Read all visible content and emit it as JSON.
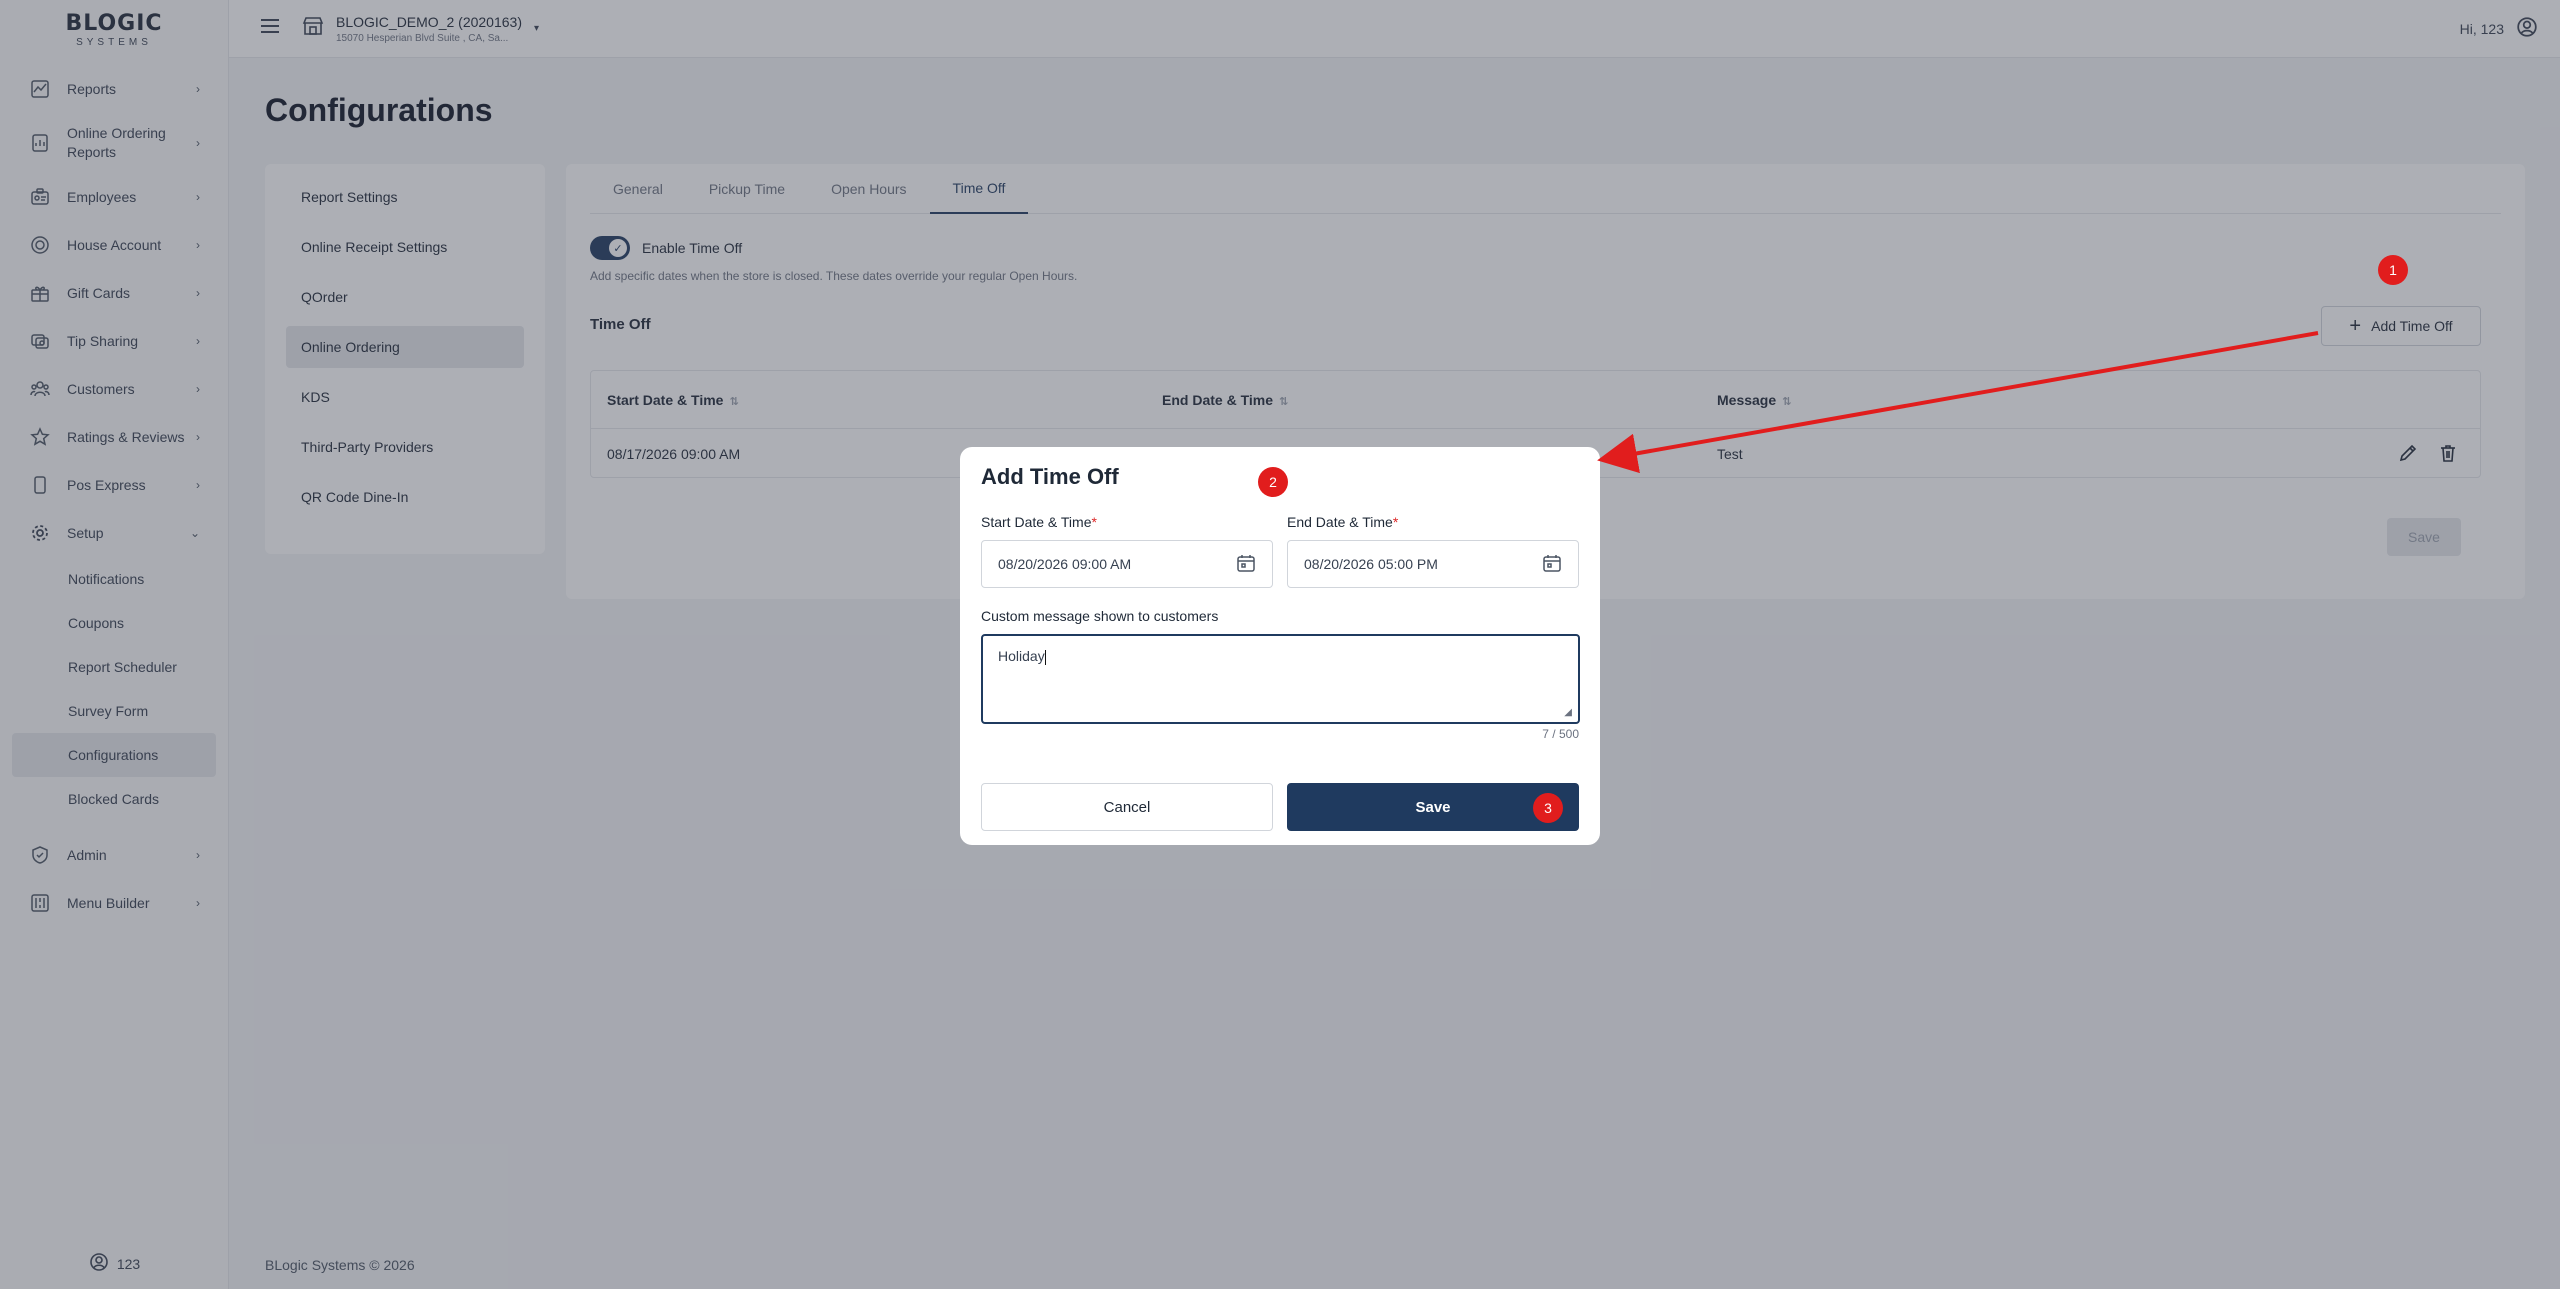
{
  "logo": {
    "line1": "BLOGIC",
    "line2": "SYSTEMS"
  },
  "sidebar": {
    "items": [
      {
        "label": "Reports",
        "icon": "chart-icon"
      },
      {
        "label": "Online Ordering Reports",
        "icon": "report-icon"
      },
      {
        "label": "Employees",
        "icon": "id-card-icon"
      },
      {
        "label": "House Account",
        "icon": "coin-icon"
      },
      {
        "label": "Gift Cards",
        "icon": "gift-icon"
      },
      {
        "label": "Tip Sharing",
        "icon": "tip-icon"
      },
      {
        "label": "Customers",
        "icon": "users-icon"
      },
      {
        "label": "Ratings & Reviews",
        "icon": "star-icon"
      },
      {
        "label": "Pos Express",
        "icon": "device-icon"
      },
      {
        "label": "Setup",
        "icon": "gear-icon"
      }
    ],
    "setup_sub": [
      "Notifications",
      "Coupons",
      "Report Scheduler",
      "Survey Form",
      "Configurations",
      "Blocked Cards"
    ],
    "bottom_items": [
      {
        "label": "Admin",
        "icon": "shield-icon"
      },
      {
        "label": "Menu Builder",
        "icon": "menu-icon"
      }
    ],
    "user": "123"
  },
  "topbar": {
    "store_name": "BLOGIC_DEMO_2 (2020163)",
    "store_address": "15070 Hesperian Blvd Suite , CA, Sa...",
    "greeting": "Hi, 123"
  },
  "page": {
    "title": "Configurations",
    "footer": "BLogic Systems © 2026"
  },
  "settings_nav": [
    "Report Settings",
    "Online Receipt Settings",
    "QOrder",
    "Online Ordering",
    "KDS",
    "Third-Party Providers",
    "QR Code Dine-In"
  ],
  "tabs": [
    "General",
    "Pickup Time",
    "Open Hours",
    "Time Off"
  ],
  "time_off": {
    "toggle_label": "Enable Time Off",
    "toggle_on": true,
    "helper": "Add specific dates when the store is closed. These dates override your regular Open Hours.",
    "section_title": "Time Off",
    "add_button": "Add Time Off",
    "columns": [
      "Start Date & Time",
      "End Date & Time",
      "Message"
    ],
    "rows": [
      {
        "start": "08/17/2026 09:00 AM",
        "end": "",
        "message": "Test"
      }
    ],
    "save": "Save"
  },
  "modal": {
    "title": "Add Time Off",
    "start_label": "Start Date & Time",
    "start_value": "08/20/2026 09:00 AM",
    "end_label": "End Date & Time",
    "end_value": "08/20/2026 05:00 PM",
    "message_label": "Custom message shown to customers",
    "message_value": "Holiday",
    "counter": "7 / 500",
    "cancel": "Cancel",
    "save": "Save"
  },
  "annotations": {
    "b1": "1",
    "b2": "2",
    "b3": "3",
    "color": "#e11d1d"
  },
  "colors": {
    "primary": "#1f3a5f",
    "accent_red": "#dc2626"
  }
}
